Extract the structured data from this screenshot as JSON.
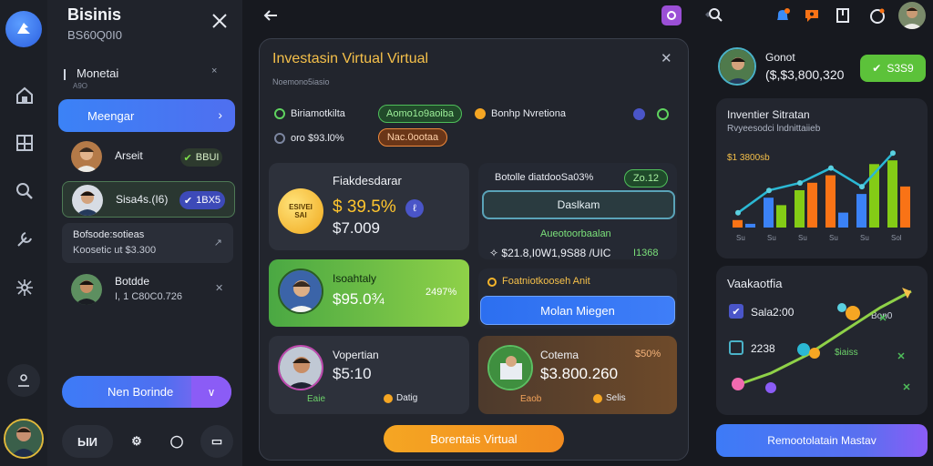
{
  "left_panel": {
    "brand": "Bisinis",
    "brand_sub": "BS60Q0I0",
    "section_title": "Monetai",
    "section_sub": "A9O",
    "section_x": "×",
    "manager_btn": "Meengar",
    "contacts": [
      {
        "name": "Arseit",
        "badge": "BBUI"
      },
      {
        "name": "Sisa4s.(I6)",
        "badge": "1BX5"
      }
    ],
    "note": {
      "line1": "Bofsode:sotieas",
      "line2": "Koosetic ut $3.300"
    },
    "contact3": {
      "name": "Botdde",
      "sub": "I, 1 C80C0.726"
    },
    "cta": "Nen Borinde",
    "bottom_buttons": [
      "ЫИ",
      "⚙",
      "◯",
      "▭"
    ]
  },
  "modal": {
    "title": "Investasin Virtual Virtual",
    "subtitle": "Noemono5iasio",
    "tag1_label": "Biriamotkilta",
    "tag1_pill": "Aomo1o9aoiba",
    "tag2_label": "Bonhp Nvretiona",
    "tag3_label": "oro $93.l0%",
    "tag3_pill": "Nac.0ootaa",
    "card_a": {
      "title": "Fiakdesdarar",
      "coin": "ESIVEI SAI",
      "pct": "$ 39.5%",
      "amount": "$7.009"
    },
    "card_b": {
      "title": "Botolle diatdooSa03%",
      "pill": "Zo.12",
      "btn": "Daslkam",
      "label": "Aueotoorbaalan",
      "amount": "✧ $21.8,I0W1,9S88 /UIC",
      "right": "I1368"
    },
    "card_c": {
      "name": "Isoahtaly",
      "amount": "$95.0¾",
      "pct": "2497%"
    },
    "card_d": {
      "label": "Foatniotkooseh Anit",
      "btn": "Molan Miegen"
    },
    "card_e": {
      "name": "Vopertian",
      "amount": "$5:10",
      "s1": "Eaie",
      "s2": "Datig"
    },
    "card_f": {
      "name": "Cotema",
      "pct": "$50%",
      "amount": "$3.800.260",
      "s1": "Eaob",
      "s2": "Selis"
    },
    "cta": "Borentais Virtual"
  },
  "right": {
    "user_name": "Gonot",
    "user_amount": "($,$3,800,320",
    "user_pill": "S3S9",
    "chart_title": "Inventier Sitratan",
    "chart_sub": "Rvyeesodci lndnittaiieb",
    "chart_value": "$1 3800sb",
    "chart_x": [
      "Su",
      "Su",
      "Su",
      "Su",
      "Su",
      "Sol"
    ],
    "chart2_title": "Vaakaotfia",
    "legend": [
      {
        "label": "Sala2:00"
      },
      {
        "label": "2238"
      }
    ],
    "chart2_side": [
      "Bon0",
      "$iaiss"
    ],
    "cta": "Remootolatain Mastav"
  },
  "chart_data": {
    "type": "bar",
    "title": "Inventier Sitratan",
    "categories": [
      "Su",
      "Su",
      "Su",
      "Su",
      "Su",
      "Sol"
    ],
    "series": [
      {
        "values": [
          2,
          8,
          10,
          14,
          9,
          18
        ]
      },
      {
        "values": [
          1,
          6,
          12,
          4,
          17,
          11
        ]
      }
    ],
    "colors": [
      "#f97316",
      "#3b82f6",
      "#84cc16"
    ],
    "ylim": [
      0,
      20
    ]
  }
}
